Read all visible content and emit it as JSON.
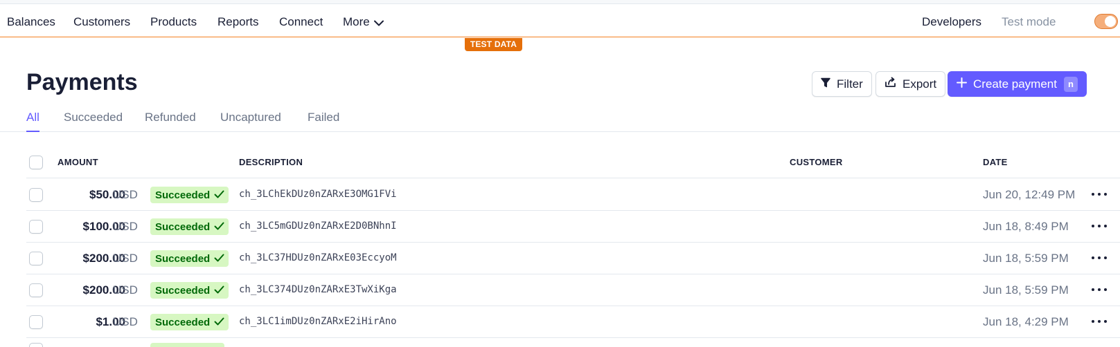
{
  "nav": {
    "items": [
      "Balances",
      "Customers",
      "Products",
      "Reports",
      "Connect"
    ],
    "more_label": "More",
    "developers_label": "Developers",
    "test_mode_label": "Test mode",
    "test_mode_on": true,
    "test_data_badge": "TEST DATA",
    "accent_color": "#f5801f"
  },
  "page": {
    "title": "Payments"
  },
  "actions": {
    "filter_label": "Filter",
    "export_label": "Export",
    "create_label": "Create payment",
    "create_shortcut": "n",
    "primary_color": "#635bff"
  },
  "tabs": [
    {
      "label": "All",
      "active": true
    },
    {
      "label": "Succeeded",
      "active": false
    },
    {
      "label": "Refunded",
      "active": false
    },
    {
      "label": "Uncaptured",
      "active": false
    },
    {
      "label": "Failed",
      "active": false
    }
  ],
  "table": {
    "columns": {
      "amount": "AMOUNT",
      "description": "DESCRIPTION",
      "customer": "CUSTOMER",
      "date": "DATE"
    },
    "rows": [
      {
        "amount": "$50.00",
        "currency": "USD",
        "status": "Succeeded",
        "description": "ch_3LChEkDUz0nZARxE3OMG1FVi",
        "customer": "",
        "date": "Jun 20, 12:49 PM"
      },
      {
        "amount": "$100.00",
        "currency": "USD",
        "status": "Succeeded",
        "description": "ch_3LC5mGDUz0nZARxE2D0BNhnI",
        "customer": "",
        "date": "Jun 18, 8:49 PM"
      },
      {
        "amount": "$200.00",
        "currency": "USD",
        "status": "Succeeded",
        "description": "ch_3LC37HDUz0nZARxE03EccyoM",
        "customer": "",
        "date": "Jun 18, 5:59 PM"
      },
      {
        "amount": "$200.00",
        "currency": "USD",
        "status": "Succeeded",
        "description": "ch_3LC374DUz0nZARxE3TwXiKga",
        "customer": "",
        "date": "Jun 18, 5:59 PM"
      },
      {
        "amount": "$1.00",
        "currency": "USD",
        "status": "Succeeded",
        "description": "ch_3LC1imDUz0nZARxE2iHirAno",
        "customer": "",
        "date": "Jun 18, 4:29 PM"
      }
    ],
    "status_color": "#006908",
    "status_bg": "#d7f7c2"
  }
}
